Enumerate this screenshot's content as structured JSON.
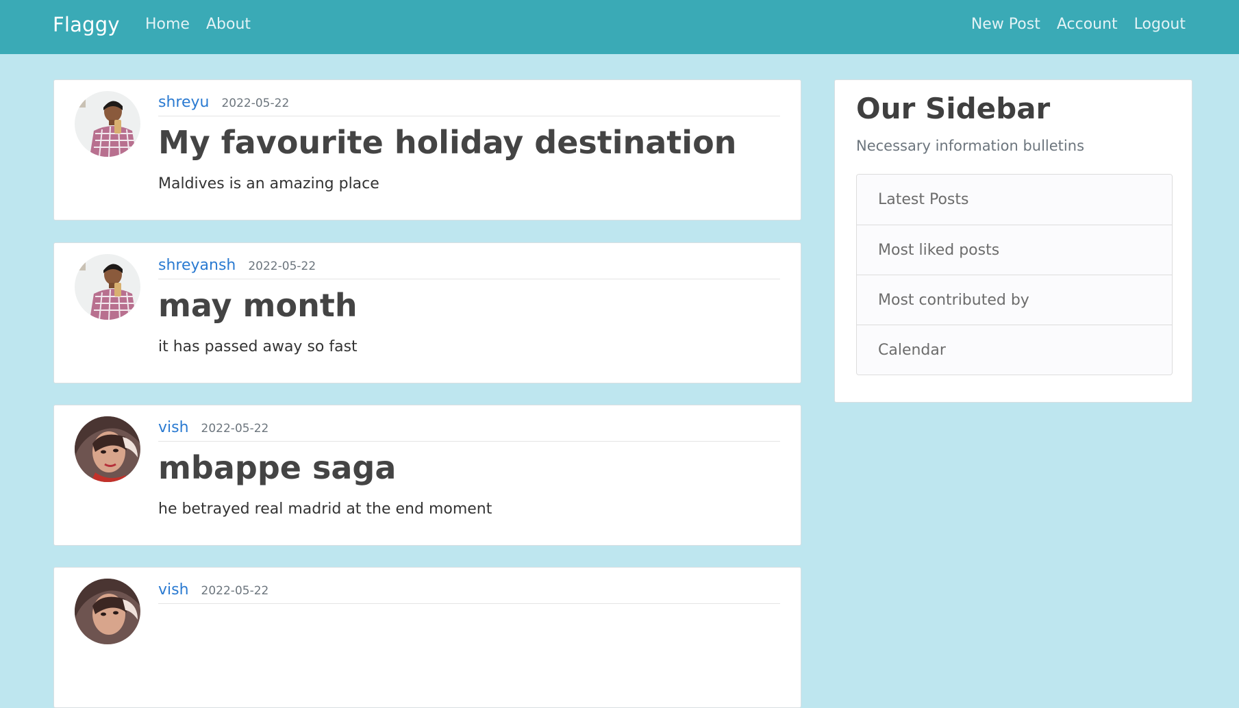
{
  "navbar": {
    "brand": "Flaggy",
    "left_links": [
      "Home",
      "About"
    ],
    "right_links": [
      "New Post",
      "Account",
      "Logout"
    ],
    "color": "#3aaab6"
  },
  "page": {
    "background": "#bee6ef"
  },
  "posts": [
    {
      "author": "shreyu",
      "date": "2022-05-22",
      "title": "My favourite holiday destination",
      "content": "Maldives is an amazing place",
      "avatar_icon": "user-avatar-man"
    },
    {
      "author": "shreyansh",
      "date": "2022-05-22",
      "title": "may month",
      "content": "it has passed away so fast",
      "avatar_icon": "user-avatar-man"
    },
    {
      "author": "vish",
      "date": "2022-05-22",
      "title": "mbappe saga",
      "content": "he betrayed real madrid at the end moment",
      "avatar_icon": "user-avatar-woman"
    },
    {
      "author": "vish",
      "date": "2022-05-22",
      "title": "",
      "content": "",
      "avatar_icon": "user-avatar-woman"
    }
  ],
  "sidebar": {
    "title": "Our Sidebar",
    "subtitle": "Necessary information bulletins",
    "items": [
      "Latest Posts",
      "Most liked posts",
      "Most contributed by",
      "Calendar"
    ]
  },
  "colors": {
    "author_link": "#2a7ad1"
  }
}
